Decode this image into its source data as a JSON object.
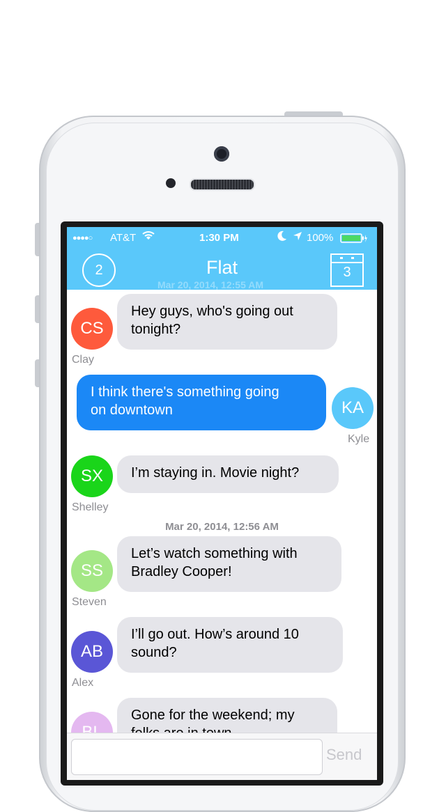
{
  "status_bar": {
    "signal": "●●●●○",
    "carrier": "AT&T",
    "wifi_icon": "wifi-icon",
    "time": "1:30 PM",
    "battery": "100%"
  },
  "nav": {
    "badge_count": "2",
    "title": "Flat",
    "calendar_count": "3"
  },
  "ghost_timestamp": "Mar 20, 2014, 12:55 AM",
  "messages": [
    {
      "initials": "CS",
      "name": "Clay",
      "text1": "Hey guys, who's going out",
      "text2": "tonight?",
      "color": "#fe5a3c"
    },
    {
      "initials": "KA",
      "name": "Kyle",
      "text1": "I think there's something going",
      "text2": "on downtown",
      "color": "#5ac8fa"
    },
    {
      "initials": "SX",
      "name": "Shelley",
      "text1": "I’m staying in. Movie night?",
      "color": "#1ad51a"
    },
    {
      "initials": "SS",
      "name": "Steven",
      "text1": "Let’s watch something with",
      "text2": "Bradley Cooper!",
      "color": "#a4e786"
    },
    {
      "initials": "AB",
      "name": "Alex",
      "text1": "I’ll go out. How’s around 10",
      "text2": "sound?",
      "color": "#5a56d6"
    },
    {
      "initials": "BL",
      "text1": "Gone for the weekend; my",
      "text2": "folks are in town",
      "color": "#e4b8f0"
    }
  ],
  "timestamp": "Mar 20, 2014, 12:56 AM",
  "composer": {
    "placeholder": "",
    "send_label": "Send"
  }
}
